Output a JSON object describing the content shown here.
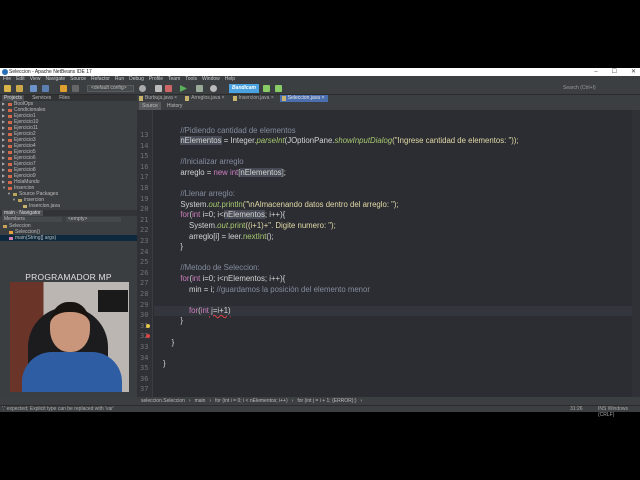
{
  "window": {
    "title": "Seleccion - Apache NetBeans IDE 17",
    "controls": [
      "–",
      "☐",
      "✕"
    ]
  },
  "menu": [
    "File",
    "Edit",
    "View",
    "Navigate",
    "Source",
    "Refactor",
    "Run",
    "Debug",
    "Profile",
    "Team",
    "Tools",
    "Window",
    "Help"
  ],
  "toolbar": {
    "config": "<default config>",
    "logo": "Bandicam",
    "search_placeholder": "Search (Ctrl+I)"
  },
  "projects": {
    "tabs": [
      "Projects",
      "Services",
      "Files"
    ],
    "items": [
      {
        "label": "BoolOps",
        "level": 0
      },
      {
        "label": "Condicionales",
        "level": 0
      },
      {
        "label": "Ejercicio1",
        "level": 0
      },
      {
        "label": "Ejercicio10",
        "level": 0
      },
      {
        "label": "Ejercicio11",
        "level": 0
      },
      {
        "label": "Ejercicio2",
        "level": 0
      },
      {
        "label": "Ejercicio3",
        "level": 0
      },
      {
        "label": "Ejercicio4",
        "level": 0
      },
      {
        "label": "Ejercicio5",
        "level": 0
      },
      {
        "label": "Ejercicio6",
        "level": 0
      },
      {
        "label": "Ejercicio7",
        "level": 0
      },
      {
        "label": "Ejercicio8",
        "level": 0
      },
      {
        "label": "Ejercicio9",
        "level": 0
      },
      {
        "label": "HolaMundo",
        "level": 0
      },
      {
        "label": "Insercion",
        "level": 0
      },
      {
        "label": "Source Packages",
        "level": 1
      },
      {
        "label": "insercion",
        "level": 2
      },
      {
        "label": "Insercion.java",
        "level": 3
      }
    ]
  },
  "navigator": {
    "title": "main - Navigator",
    "members": "Members",
    "filter": "<empty>",
    "items": [
      {
        "label": "Seleccion",
        "level": 0
      },
      {
        "label": "Seleccion()",
        "level": 1
      },
      {
        "label": "main(String[] args)",
        "level": 1
      }
    ]
  },
  "webcam": {
    "title": "PROGRAMADOR MP"
  },
  "editor": {
    "tabs": [
      {
        "label": "Burbuja.java",
        "active": false
      },
      {
        "label": "Arreglos.java",
        "active": false
      },
      {
        "label": "Insercion.java",
        "active": false
      },
      {
        "label": "Seleccion.java",
        "active": true
      }
    ],
    "modes": [
      "Source",
      "History"
    ],
    "current_line": 31,
    "lines": [
      {
        "n": 13,
        "t": []
      },
      {
        "n": 14,
        "t": [
          {
            "s": "        ",
            "k": ""
          },
          {
            "s": "//Pidiendo cantidad de elementos",
            "k": "cm"
          }
        ]
      },
      {
        "n": 15,
        "t": [
          {
            "s": "        ",
            "k": ""
          },
          {
            "s": "nElementos",
            "k": "hl"
          },
          {
            "s": " = Integer.",
            "k": ""
          },
          {
            "s": "parseInt",
            "k": "me"
          },
          {
            "s": "(JOptionPane.",
            "k": ""
          },
          {
            "s": "showInputDialog",
            "k": "me"
          },
          {
            "s": "(\"Ingrese cantidad de elementos: \"));",
            "k": "st"
          }
        ]
      },
      {
        "n": 16,
        "t": []
      },
      {
        "n": 17,
        "t": [
          {
            "s": "        ",
            "k": ""
          },
          {
            "s": "//Inicializar arreglo",
            "k": "cm"
          }
        ]
      },
      {
        "n": 18,
        "t": [
          {
            "s": "        arreglo = ",
            "k": ""
          },
          {
            "s": "new int",
            "k": "kw"
          },
          {
            "s": "[",
            "k": ""
          },
          {
            "s": "nElementos",
            "k": "hl"
          },
          {
            "s": "];",
            "k": ""
          }
        ]
      },
      {
        "n": 19,
        "t": []
      },
      {
        "n": 20,
        "t": [
          {
            "s": "        ",
            "k": ""
          },
          {
            "s": "//Llenar arreglo:",
            "k": "cm"
          }
        ]
      },
      {
        "n": 21,
        "t": [
          {
            "s": "        System.",
            "k": ""
          },
          {
            "s": "out",
            "k": "me"
          },
          {
            "s": ".",
            "k": ""
          },
          {
            "s": "println",
            "k": "fn"
          },
          {
            "s": "(\"\\nAlmacenando datos dentro del arreglo: \");",
            "k": "st"
          }
        ]
      },
      {
        "n": 22,
        "t": [
          {
            "s": "        ",
            "k": ""
          },
          {
            "s": "for",
            "k": "kw"
          },
          {
            "s": "(",
            "k": ""
          },
          {
            "s": "int",
            "k": "kw"
          },
          {
            "s": " i=0; i<",
            "k": ""
          },
          {
            "s": "nElementos",
            "k": "hl"
          },
          {
            "s": "; i++){",
            "k": ""
          }
        ]
      },
      {
        "n": 23,
        "t": [
          {
            "s": "            System.",
            "k": ""
          },
          {
            "s": "out",
            "k": "me"
          },
          {
            "s": ".",
            "k": ""
          },
          {
            "s": "print",
            "k": "fn"
          },
          {
            "s": "((i+1)+\". Digite numero: \");",
            "k": "st"
          }
        ]
      },
      {
        "n": 24,
        "t": [
          {
            "s": "            arreglo[i] = leer.",
            "k": ""
          },
          {
            "s": "nextInt",
            "k": "fn"
          },
          {
            "s": "();",
            "k": ""
          }
        ]
      },
      {
        "n": 25,
        "t": [
          {
            "s": "        }",
            "k": ""
          }
        ]
      },
      {
        "n": 26,
        "t": []
      },
      {
        "n": 27,
        "t": [
          {
            "s": "        ",
            "k": ""
          },
          {
            "s": "//Metodo de Seleccion:",
            "k": "cm"
          }
        ]
      },
      {
        "n": 28,
        "t": [
          {
            "s": "        ",
            "k": ""
          },
          {
            "s": "for",
            "k": "kw"
          },
          {
            "s": "(",
            "k": ""
          },
          {
            "s": "int",
            "k": "kw"
          },
          {
            "s": " i=0; i<nElementos; i++){",
            "k": ""
          }
        ]
      },
      {
        "n": 29,
        "t": [
          {
            "s": "            min = i; ",
            "k": ""
          },
          {
            "s": "//guardamos la posición del elemento menor",
            "k": "cm"
          }
        ]
      },
      {
        "n": 30,
        "t": []
      },
      {
        "n": 31,
        "t": [
          {
            "s": "            ",
            "k": ""
          },
          {
            "s": "for",
            "k": "kw"
          },
          {
            "s": "(",
            "k": ""
          },
          {
            "s": "int",
            "k": "kw"
          },
          {
            "s": " j=i+1)",
            "k": "err"
          }
        ]
      },
      {
        "n": 32,
        "t": [
          {
            "s": "        }",
            "k": ""
          }
        ]
      },
      {
        "n": 33,
        "t": []
      },
      {
        "n": 34,
        "t": [
          {
            "s": "    }",
            "k": ""
          }
        ]
      },
      {
        "n": 35,
        "t": []
      },
      {
        "n": 36,
        "t": [
          {
            "s": "}",
            "k": ""
          }
        ]
      },
      {
        "n": 37,
        "t": []
      }
    ]
  },
  "breadcrumb": [
    "seleccion.Seleccion",
    "main",
    "for (int i = 0; i < nElementos; i++)",
    "for (int j = i + 1; {ERROR};)"
  ],
  "status": {
    "message": "'.' expected; Explicit type can be replaced with 'var'",
    "position": "31:26",
    "mode": "INS Windows (CRLF)"
  }
}
